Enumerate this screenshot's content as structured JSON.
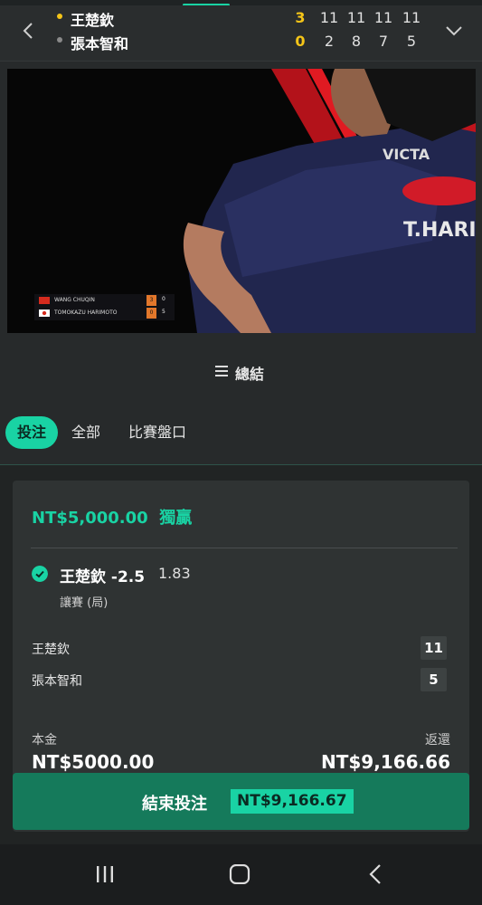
{
  "match": {
    "players": [
      {
        "name": "王楚欽",
        "sets": "3",
        "games": [
          "11",
          "11",
          "11",
          "11"
        ],
        "serve_dot": "#f5c518"
      },
      {
        "name": "張本智和",
        "sets": "0",
        "games": [
          "2",
          "8",
          "7",
          "5"
        ],
        "serve_dot": "#8a8a8a"
      }
    ]
  },
  "video_overlay": {
    "rows": [
      {
        "name": "WANG CHUQIN",
        "sets": "3",
        "points": "0"
      },
      {
        "name": "TOMOKAZU HARIMOTO",
        "sets": "0",
        "points": "5"
      }
    ]
  },
  "summary": {
    "label": "總結"
  },
  "tabs": [
    {
      "label": "投注",
      "active": true
    },
    {
      "label": "全部",
      "active": false
    },
    {
      "label": "比賽盤口",
      "active": false
    }
  ],
  "bet": {
    "title": "NT$5,000.00  獨贏",
    "selection": "王楚欽 -2.5",
    "odds": "1.83",
    "market": "讓賽 (局)",
    "score_rows": [
      {
        "player": "王楚欽",
        "score": "11"
      },
      {
        "player": "張本智和",
        "score": "5"
      }
    ],
    "stake_label": "本金",
    "stake_value": "NT$5000.00",
    "return_label": "返還",
    "return_value": "NT$9,166.66",
    "cashout_label": "結束投注",
    "cashout_value": "NT$9,166.67"
  },
  "colors": {
    "accent": "#19d3a4",
    "cashout_bg": "#157a5b",
    "highlight": "#f5c518"
  },
  "icons": [
    "back-arrow-icon",
    "chevron-down-icon",
    "menu-lines-icon",
    "check-circle-icon",
    "recent-apps-icon",
    "home-icon",
    "back-icon"
  ]
}
